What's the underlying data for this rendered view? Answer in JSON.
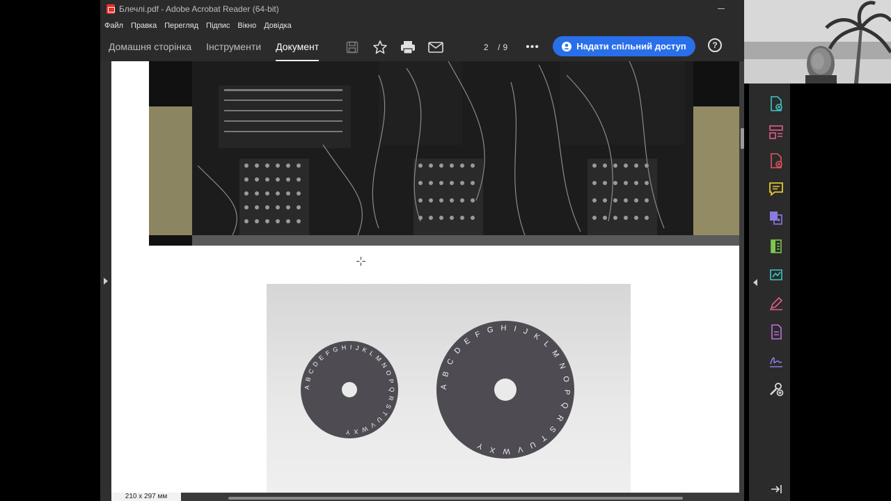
{
  "window": {
    "title": "Блечлі.pdf - Adobe Acrobat Reader (64-bit)"
  },
  "menu": [
    "Файл",
    "Правка",
    "Перегляд",
    "Підпис",
    "Вікно",
    "Довідка"
  ],
  "tabs": {
    "home": "Домашня сторінка",
    "tools": "Інструменти",
    "document": "Документ"
  },
  "pager": {
    "current": "2",
    "separator": "/",
    "total": "9"
  },
  "share_button": {
    "label": "Надати спільний доступ"
  },
  "help": {
    "label": "?"
  },
  "status": {
    "page_size": "210 x 297 мм"
  },
  "wheels": {
    "small": "ABCDEFGHIJKLMNOPQRSTUVWXY",
    "large": "ABCDEFGHIJKLMNOPQRSTUVWXY"
  },
  "colors": {
    "accent": "#2a6fea",
    "tool_icon": "#3cc6c6",
    "pdf_red": "#e0312b"
  },
  "right_tools": [
    "create-pdf-icon",
    "organize-pages-icon",
    "export-pdf-icon",
    "comment-icon",
    "combine-files-icon",
    "compress-icon",
    "fill-sign-icon",
    "edit-icon",
    "request-signature-icon",
    "signature-icon",
    "more-tools-icon",
    "expand-panel-icon"
  ]
}
